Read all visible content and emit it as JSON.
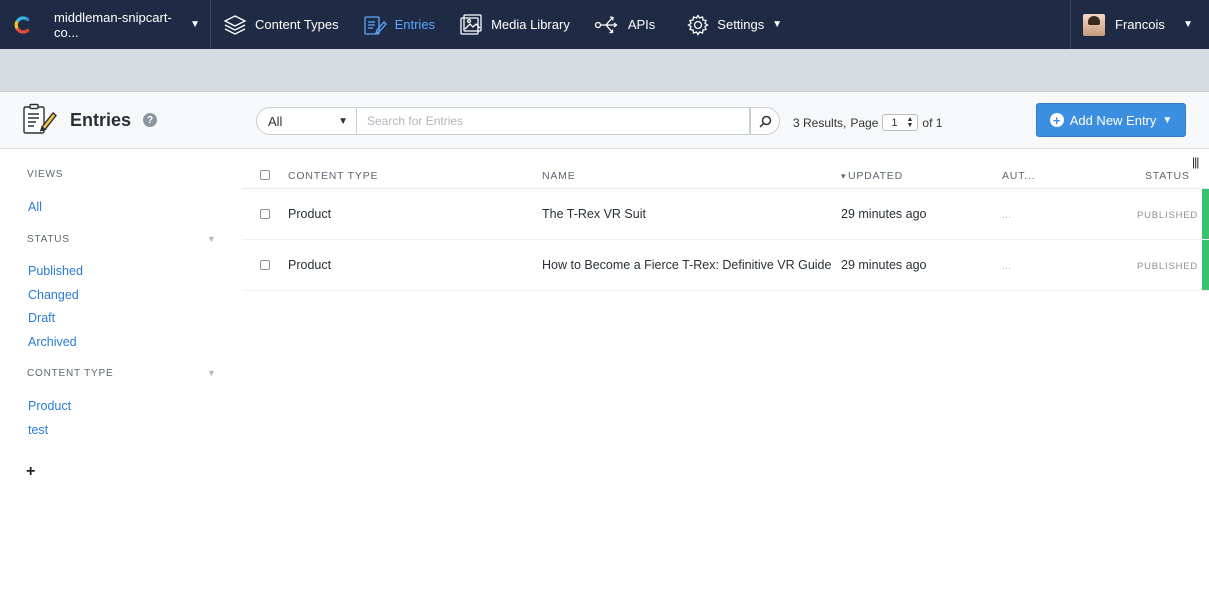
{
  "topnav": {
    "space_name": "middleman-snipcart-co...",
    "items": [
      {
        "label": "Content Types",
        "icon": "layers-icon"
      },
      {
        "label": "Entries",
        "icon": "entries-icon",
        "active": true
      },
      {
        "label": "Media Library",
        "icon": "image-icon"
      },
      {
        "label": "APIs",
        "icon": "api-icon"
      },
      {
        "label": "Settings",
        "icon": "gear-icon"
      }
    ],
    "user_name": "Francois"
  },
  "header": {
    "title": "Entries",
    "help": "?",
    "filter_selected": "All",
    "search_placeholder": "Search for Entries",
    "results_text": "3 Results,",
    "page_label": "Page",
    "page_value": "1",
    "page_total": "of 1",
    "add_button": "Add New Entry"
  },
  "sidebar": {
    "views_title": "VIEWS",
    "views": [
      "All"
    ],
    "status_title": "STATUS",
    "status_items": [
      "Published",
      "Changed",
      "Draft",
      "Archived"
    ],
    "content_type_title": "CONTENT TYPE",
    "content_types": [
      "Product",
      "test"
    ],
    "add_symbol": "+"
  },
  "table": {
    "columns": [
      "CONTENT TYPE",
      "NAME",
      "UPDATED",
      "AUT...",
      "STATUS"
    ],
    "rows": [
      {
        "content_type": "Product",
        "name": "The T-Rex VR Suit",
        "updated": "29 minutes ago",
        "author": "...",
        "status": "PUBLISHED"
      },
      {
        "content_type": "Product",
        "name": "How to Become a Fierce T-Rex: Definitive VR Guide",
        "updated": "29 minutes ago",
        "author": "...",
        "status": "PUBLISHED"
      }
    ]
  },
  "colors": {
    "nav_bg": "#1f2a44",
    "accent": "#3c8fe0",
    "published": "#39c36c",
    "link": "#2b7bd1"
  }
}
